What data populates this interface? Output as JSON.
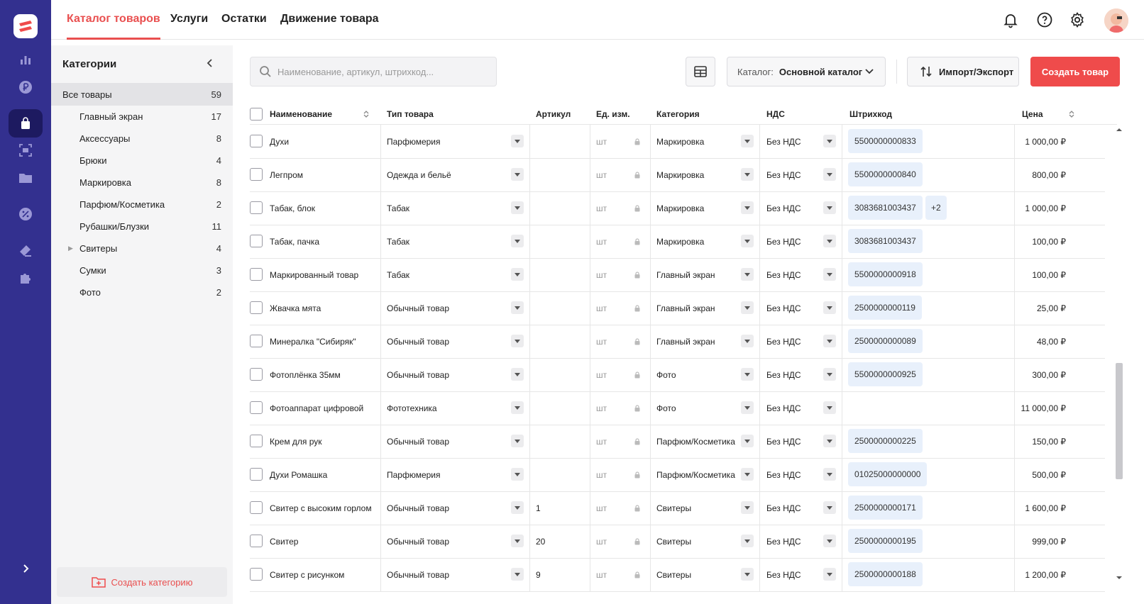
{
  "topnav": {
    "tabs": [
      {
        "label": "Каталог товаров",
        "active": true
      },
      {
        "label": "Услуги"
      },
      {
        "label": "Остатки"
      },
      {
        "label": "Движение товара"
      }
    ]
  },
  "rail": {
    "items": [
      "logo-icon",
      "chart-icon",
      "ruble-icon",
      "bag-icon",
      "scan-icon",
      "folder-icon",
      "discount-icon",
      "ticket-icon",
      "puzzle-icon",
      "expand-icon"
    ],
    "active": "bag-icon"
  },
  "sidebar": {
    "title": "Категории",
    "categories": [
      {
        "label": "Все товары",
        "count": "59"
      },
      {
        "label": "Главный экран",
        "count": "17"
      },
      {
        "label": "Аксессуары",
        "count": "8"
      },
      {
        "label": "Брюки",
        "count": "4"
      },
      {
        "label": "Маркировка",
        "count": "8"
      },
      {
        "label": "Парфюм/Косметика",
        "count": "2"
      },
      {
        "label": "Рубашки/Блузки",
        "count": "11"
      },
      {
        "label": "Свитеры",
        "count": "4"
      },
      {
        "label": "Сумки",
        "count": "3"
      },
      {
        "label": "Фото",
        "count": "2"
      }
    ],
    "create_label": "Создать категорию"
  },
  "toolbar": {
    "search_placeholder": "Наименование, артикул, штрихкод...",
    "catalog_label": "Каталог:",
    "catalog_value": "Основной каталог",
    "import_label": "Импорт/Экспорт",
    "create_label": "Создать товар"
  },
  "table": {
    "headers": {
      "name": "Наименование",
      "type": "Тип товара",
      "sku": "Артикул",
      "unit": "Ед. изм.",
      "category": "Категория",
      "vat": "НДС",
      "barcode": "Штрихкод",
      "price": "Цена"
    },
    "rows": [
      {
        "name": "Духи",
        "type": "Парфюмерия",
        "sku": "",
        "unit": "шт",
        "category": "Маркировка",
        "vat": "Без НДС",
        "barcode": "5500000000833",
        "extra": "",
        "price": "1 000,00 ₽"
      },
      {
        "name": "Легпром",
        "type": "Одежда и бельё",
        "sku": "",
        "unit": "шт",
        "category": "Маркировка",
        "vat": "Без НДС",
        "barcode": "5500000000840",
        "extra": "",
        "price": "800,00 ₽"
      },
      {
        "name": "Табак, блок",
        "type": "Табак",
        "sku": "",
        "unit": "шт",
        "category": "Маркировка",
        "vat": "Без НДС",
        "barcode": "3083681003437",
        "extra": "+2",
        "price": "1 000,00 ₽"
      },
      {
        "name": "Табак, пачка",
        "type": "Табак",
        "sku": "",
        "unit": "шт",
        "category": "Маркировка",
        "vat": "Без НДС",
        "barcode": "3083681003437",
        "extra": "",
        "price": "100,00 ₽"
      },
      {
        "name": "Маркированный товар",
        "type": "Табак",
        "sku": "",
        "unit": "шт",
        "category": "Главный экран",
        "vat": "Без НДС",
        "barcode": "5500000000918",
        "extra": "",
        "price": "100,00 ₽"
      },
      {
        "name": "Жвачка мята",
        "type": "Обычный товар",
        "sku": "",
        "unit": "шт",
        "category": "Главный экран",
        "vat": "Без НДС",
        "barcode": "2500000000119",
        "extra": "",
        "price": "25,00 ₽"
      },
      {
        "name": "Минералка \"Сибиряк\"",
        "type": "Обычный товар",
        "sku": "",
        "unit": "шт",
        "category": "Главный экран",
        "vat": "Без НДС",
        "barcode": "2500000000089",
        "extra": "",
        "price": "48,00 ₽"
      },
      {
        "name": "Фотоплёнка 35мм",
        "type": "Обычный товар",
        "sku": "",
        "unit": "шт",
        "category": "Фото",
        "vat": "Без НДС",
        "barcode": "5500000000925",
        "extra": "",
        "price": "300,00 ₽"
      },
      {
        "name": "Фотоаппарат цифровой",
        "type": "Фототехника",
        "sku": "",
        "unit": "шт",
        "category": "Фото",
        "vat": "Без НДС",
        "barcode": "",
        "extra": "",
        "price": "11 000,00 ₽"
      },
      {
        "name": "Крем для рук",
        "type": "Обычный товар",
        "sku": "",
        "unit": "шт",
        "category": "Парфюм/Косметика",
        "vat": "Без НДС",
        "barcode": "2500000000225",
        "extra": "",
        "price": "150,00 ₽"
      },
      {
        "name": "Духи Ромашка",
        "type": "Парфюмерия",
        "sku": "",
        "unit": "шт",
        "category": "Парфюм/Косметика",
        "vat": "Без НДС",
        "barcode": "01025000000000",
        "extra": "",
        "price": "500,00 ₽"
      },
      {
        "name": "Свитер с высоким горлом",
        "type": "Обычный товар",
        "sku": "1",
        "unit": "шт",
        "category": "Свитеры",
        "vat": "Без НДС",
        "barcode": "2500000000171",
        "extra": "",
        "price": "1 600,00 ₽"
      },
      {
        "name": "Свитер",
        "type": "Обычный товар",
        "sku": "20",
        "unit": "шт",
        "category": "Свитеры",
        "vat": "Без НДС",
        "barcode": "2500000000195",
        "extra": "",
        "price": "999,00 ₽"
      },
      {
        "name": "Свитер с рисунком",
        "type": "Обычный товар",
        "sku": "9",
        "unit": "шт",
        "category": "Свитеры",
        "vat": "Без НДС",
        "barcode": "2500000000188",
        "extra": "",
        "price": "1 200,00 ₽"
      }
    ]
  },
  "colors": {
    "rail": "#33308f",
    "accent": "#ef4b4b",
    "barcode_bg": "#e8f0fb"
  }
}
